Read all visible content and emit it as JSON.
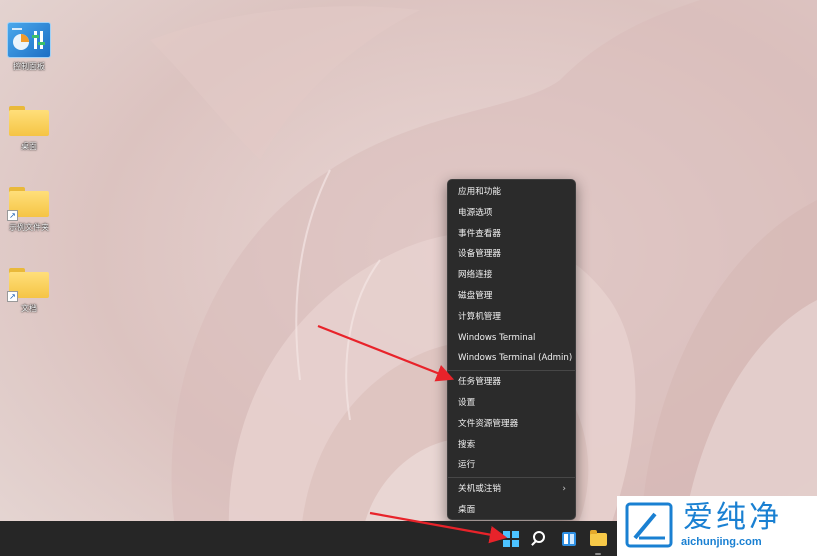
{
  "desktop": {
    "icons": [
      {
        "label": "控制面板",
        "kind": "control-panel"
      },
      {
        "label": "桌面",
        "kind": "folder"
      },
      {
        "label": "示例文件夹",
        "kind": "folder-shortcut"
      },
      {
        "label": "文档",
        "kind": "folder-shortcut"
      }
    ]
  },
  "context_menu": {
    "items": [
      {
        "label": "应用和功能"
      },
      {
        "label": "电源选项"
      },
      {
        "label": "事件查看器"
      },
      {
        "label": "设备管理器"
      },
      {
        "label": "网络连接"
      },
      {
        "label": "磁盘管理"
      },
      {
        "label": "计算机管理"
      },
      {
        "label": "Windows Terminal"
      },
      {
        "label": "Windows Terminal (Admin)"
      },
      {
        "label": "任务管理器"
      },
      {
        "label": "设置"
      },
      {
        "label": "文件资源管理器"
      },
      {
        "label": "搜索"
      },
      {
        "label": "运行"
      },
      {
        "label": "关机或注销",
        "submenu_indicator": "›"
      },
      {
        "label": "桌面"
      }
    ]
  },
  "taskbar": {
    "buttons": [
      {
        "name": "start",
        "icon": "windows-start-icon"
      },
      {
        "name": "search",
        "icon": "search-icon"
      },
      {
        "name": "widgets",
        "icon": "widgets-icon"
      },
      {
        "name": "file-explorer",
        "icon": "folder-icon"
      }
    ]
  },
  "watermark": {
    "text": "爱纯净",
    "url": "aichunjing.com"
  },
  "colors": {
    "menu_bg": "#2b2b2b",
    "taskbar_bg": "#262626",
    "arrow": "#e8232a",
    "watermark_blue": "#1a80d2",
    "start_blue": "#4cc2ff"
  }
}
